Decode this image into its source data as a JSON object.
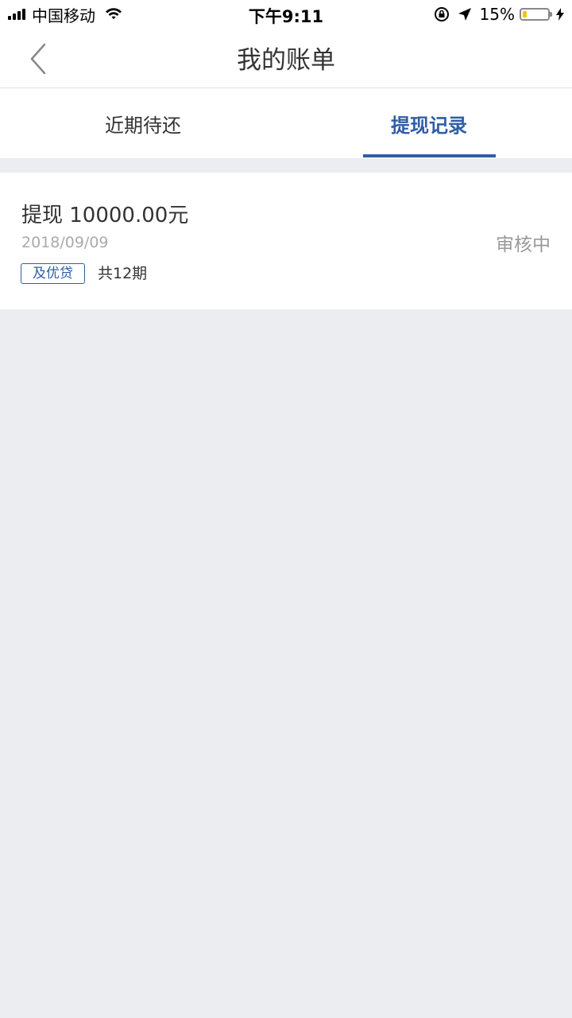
{
  "status_bar": {
    "carrier": "中国移动",
    "time": "下午9:11",
    "battery_percent": "15%",
    "battery_level": 0.15
  },
  "nav": {
    "title": "我的账单",
    "back_icon": "chevron-left-icon"
  },
  "tabs": [
    {
      "label": "近期待还",
      "active": false
    },
    {
      "label": "提现记录",
      "active": true
    }
  ],
  "records": [
    {
      "title": "提现 10000.00元",
      "date": "2018/09/09",
      "status": "审核中",
      "tag": "及优贷",
      "periods": "共12期"
    }
  ],
  "colors": {
    "accent": "#2f5ea5",
    "background": "#ecedf1",
    "battery_fill": "#f4c400"
  }
}
